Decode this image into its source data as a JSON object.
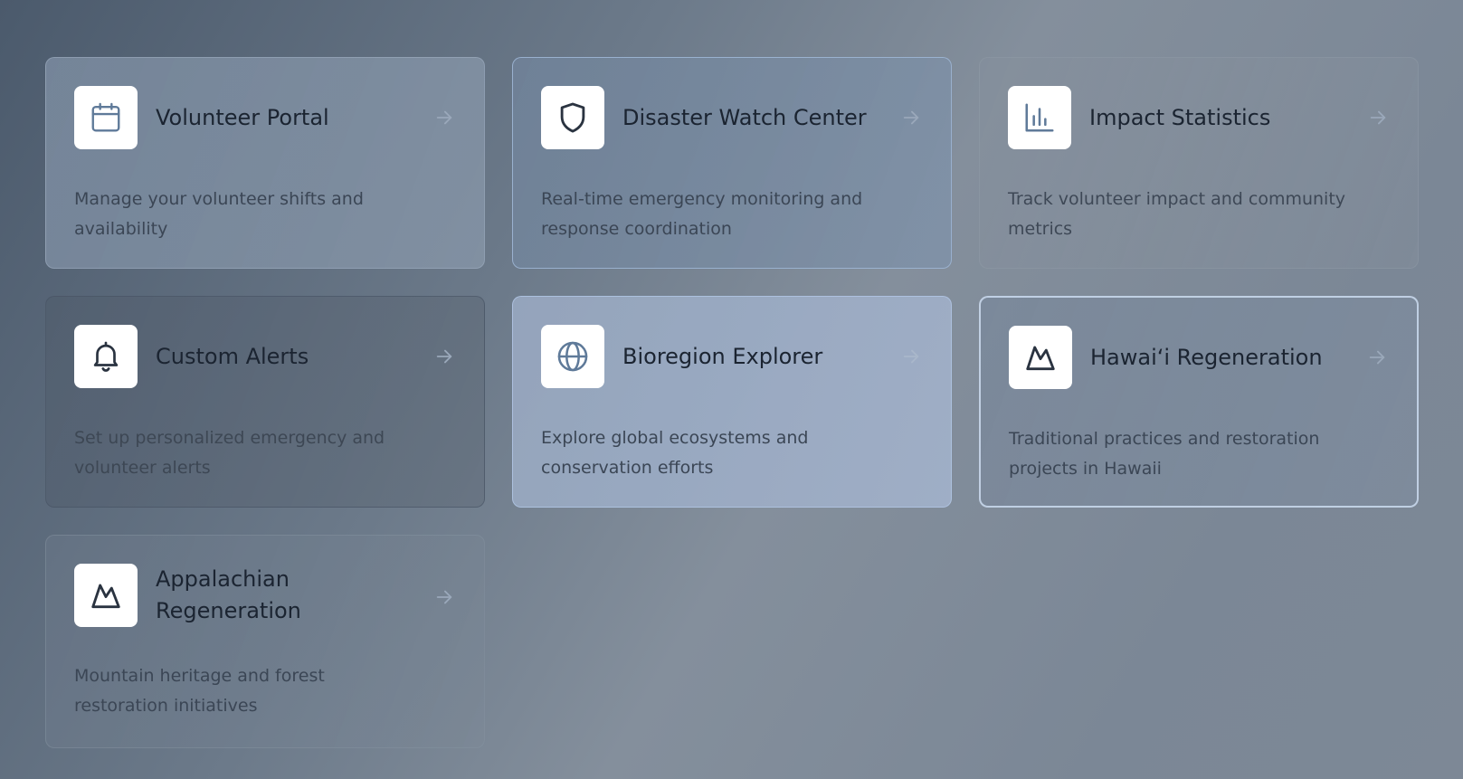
{
  "cards": [
    {
      "title": "Volunteer Portal",
      "description": "Manage your volunteer shifts and availability",
      "icon": "calendar-icon"
    },
    {
      "title": "Disaster Watch Center",
      "description": "Real-time emergency monitoring and response coordination",
      "icon": "shield-icon"
    },
    {
      "title": "Impact Statistics",
      "description": "Track volunteer impact and community metrics",
      "icon": "bar-chart-icon"
    },
    {
      "title": "Custom Alerts",
      "description": "Set up personalized emergency and volunteer alerts",
      "icon": "bell-icon"
    },
    {
      "title": "Bioregion Explorer",
      "description": "Explore global ecosystems and conservation efforts",
      "icon": "globe-icon"
    },
    {
      "title": "Hawai‘i Regeneration",
      "description": "Traditional practices and restoration projects in Hawaii",
      "icon": "mountain-icon"
    },
    {
      "title": "Appalachian Regeneration",
      "description": "Mountain heritage and forest restoration initiatives",
      "icon": "mountain-icon"
    }
  ],
  "colors": {
    "icon_stroke_blue": "#5f7a99",
    "icon_stroke_dark": "#2a3340",
    "arrow": "#9aa8ba"
  }
}
